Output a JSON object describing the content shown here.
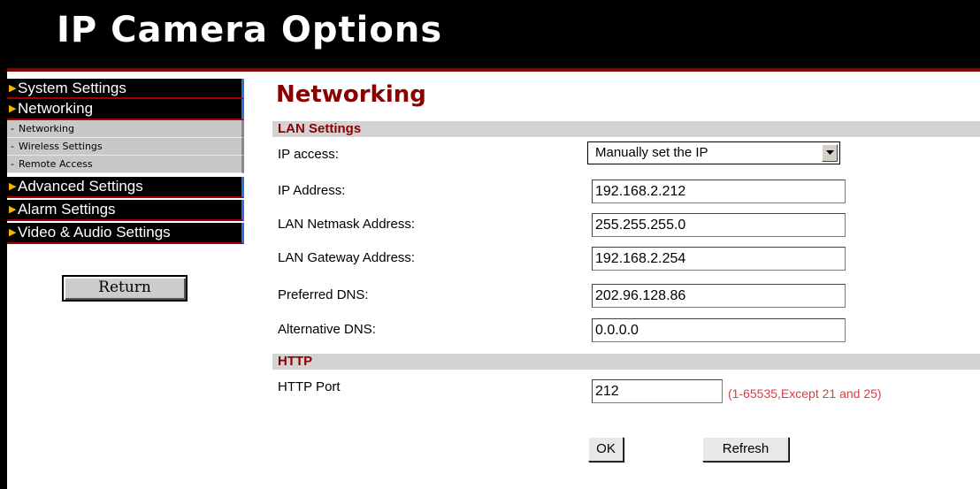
{
  "header": {
    "title": "IP Camera Options"
  },
  "sidebar": {
    "items": [
      {
        "label": "System Settings"
      },
      {
        "label": "Networking"
      },
      {
        "label": "Advanced Settings"
      },
      {
        "label": "Alarm Settings"
      },
      {
        "label": "Video & Audio Settings"
      }
    ],
    "sub_items": [
      {
        "label": "Networking"
      },
      {
        "label": "Wireless Settings"
      },
      {
        "label": "Remote Access"
      }
    ],
    "return_label": "Return"
  },
  "main": {
    "title": "Networking",
    "lan": {
      "section_title": "LAN Settings",
      "ip_access_label": "IP access:",
      "ip_access_value": "Manually set the IP",
      "ip_address_label": "IP Address:",
      "ip_address_value": "192.168.2.212",
      "netmask_label": "LAN Netmask Address:",
      "netmask_value": "255.255.255.0",
      "gateway_label": "LAN Gateway Address:",
      "gateway_value": "192.168.2.254",
      "preferred_dns_label": "Preferred DNS:",
      "preferred_dns_value": "202.96.128.86",
      "alternative_dns_label": "Alternative DNS:",
      "alternative_dns_value": "0.0.0.0"
    },
    "http": {
      "section_title": "HTTP",
      "port_label": "HTTP Port",
      "port_value": "212",
      "port_hint": "(1-65535,Except 21 and 25)"
    },
    "ok_label": "OK",
    "refresh_label": "Refresh"
  },
  "colors": {
    "banner_bg": "#000000",
    "accent_red": "#8b0000",
    "hint_red": "#dc3c3c",
    "section_bg": "#d3d3d3",
    "menu_arrow": "#f5b400",
    "menu_edge_blue": "#2f6fdc"
  },
  "icons": {
    "menu_item": "triangle-right-icon",
    "select": "chevron-down-icon"
  }
}
